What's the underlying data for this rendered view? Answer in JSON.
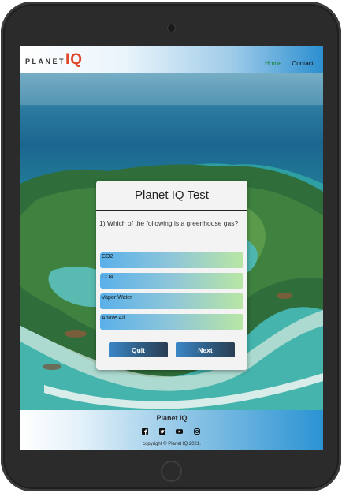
{
  "header": {
    "logo_planet": "PLANET",
    "logo_iq": "IQ",
    "nav": [
      {
        "label": "Home"
      },
      {
        "label": "Contact"
      }
    ]
  },
  "quiz": {
    "title": "Planet IQ Test",
    "question": "1) Which of the following is a greenhouse gas?",
    "options": [
      {
        "label": "CO2"
      },
      {
        "label": "CO4"
      },
      {
        "label": "Vapor Water"
      },
      {
        "label": "Above All"
      }
    ],
    "quit_label": "Quit",
    "next_label": "Next"
  },
  "footer": {
    "title": "Planet IQ",
    "socials": [
      "facebook-icon",
      "twitter-icon",
      "youtube-icon",
      "instagram-icon"
    ],
    "copyright": "copyright © Planet IQ 2021."
  },
  "colors": {
    "logo_accent": "#e0472b",
    "nav_active": "#16842b",
    "button_start": "#3b87c8",
    "button_end": "#2a3e53"
  }
}
